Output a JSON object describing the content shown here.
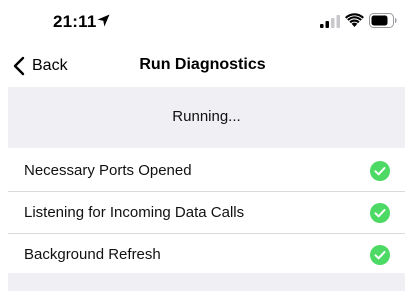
{
  "status_bar": {
    "time": "21:11",
    "icons": [
      "location-arrow-icon",
      "cellular-signal-icon",
      "wifi-icon",
      "battery-icon"
    ]
  },
  "nav": {
    "back_label": "Back",
    "title": "Run Diagnostics"
  },
  "diagnostics": {
    "status": "Running...",
    "checks": [
      {
        "label": "Necessary Ports Opened",
        "state": "passed",
        "icon": "check-circle-icon"
      },
      {
        "label": "Listening for Incoming Data Calls",
        "state": "passed",
        "icon": "check-circle-icon"
      },
      {
        "label": "Background Refresh",
        "state": "passed",
        "icon": "check-circle-icon"
      }
    ]
  },
  "colors": {
    "success_green": "#4cd964",
    "panel_gray": "#efeff4"
  }
}
